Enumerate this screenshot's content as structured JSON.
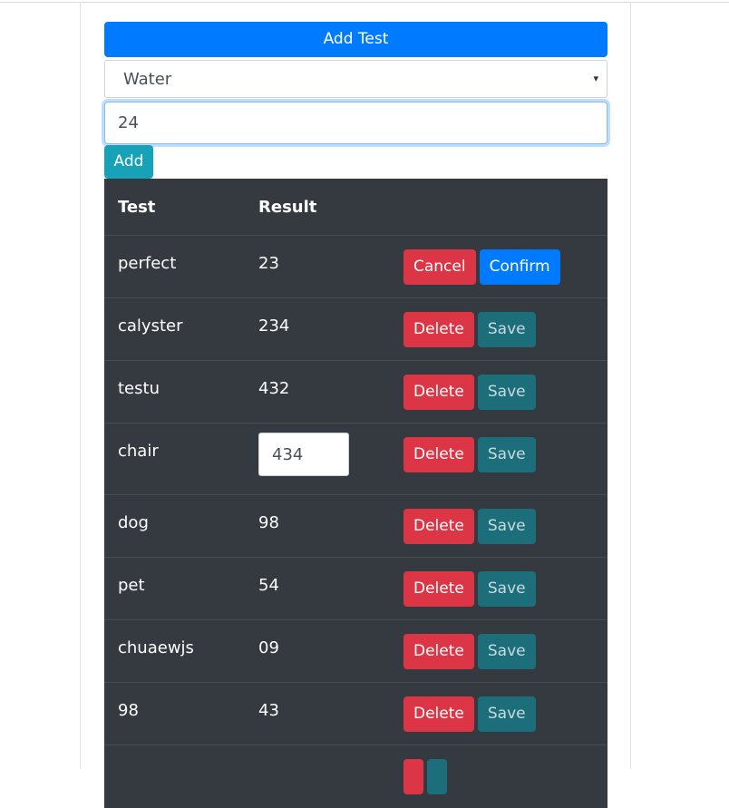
{
  "form": {
    "add_test_label": "Add Test",
    "selected_test": "Water",
    "select_caret": "▾",
    "result_value": "24",
    "add_label": "Add"
  },
  "table": {
    "headers": {
      "test": "Test",
      "result": "Result"
    },
    "rows": [
      {
        "test": "perfect",
        "result": "23",
        "left_action": "Cancel",
        "right_action": "Confirm"
      },
      {
        "test": "calyster",
        "result": "234",
        "left_action": "Delete",
        "right_action": "Save"
      },
      {
        "test": "testu",
        "result": "432",
        "left_action": "Delete",
        "right_action": "Save"
      },
      {
        "test": "chair",
        "result": "434",
        "left_action": "Delete",
        "right_action": "Save"
      },
      {
        "test": "dog",
        "result": "98",
        "left_action": "Delete",
        "right_action": "Save"
      },
      {
        "test": "pet",
        "result": "54",
        "left_action": "Delete",
        "right_action": "Save"
      },
      {
        "test": "chuaewjs",
        "result": "09",
        "left_action": "Delete",
        "right_action": "Save"
      },
      {
        "test": "98",
        "result": "43",
        "left_action": "Delete",
        "right_action": "Save"
      },
      {
        "test": "",
        "result": "",
        "left_action": "",
        "right_action": ""
      }
    ]
  },
  "colors": {
    "primary": "#007bff",
    "info": "#17a2b8",
    "danger": "#dc3545",
    "table_bg": "#343a40"
  }
}
